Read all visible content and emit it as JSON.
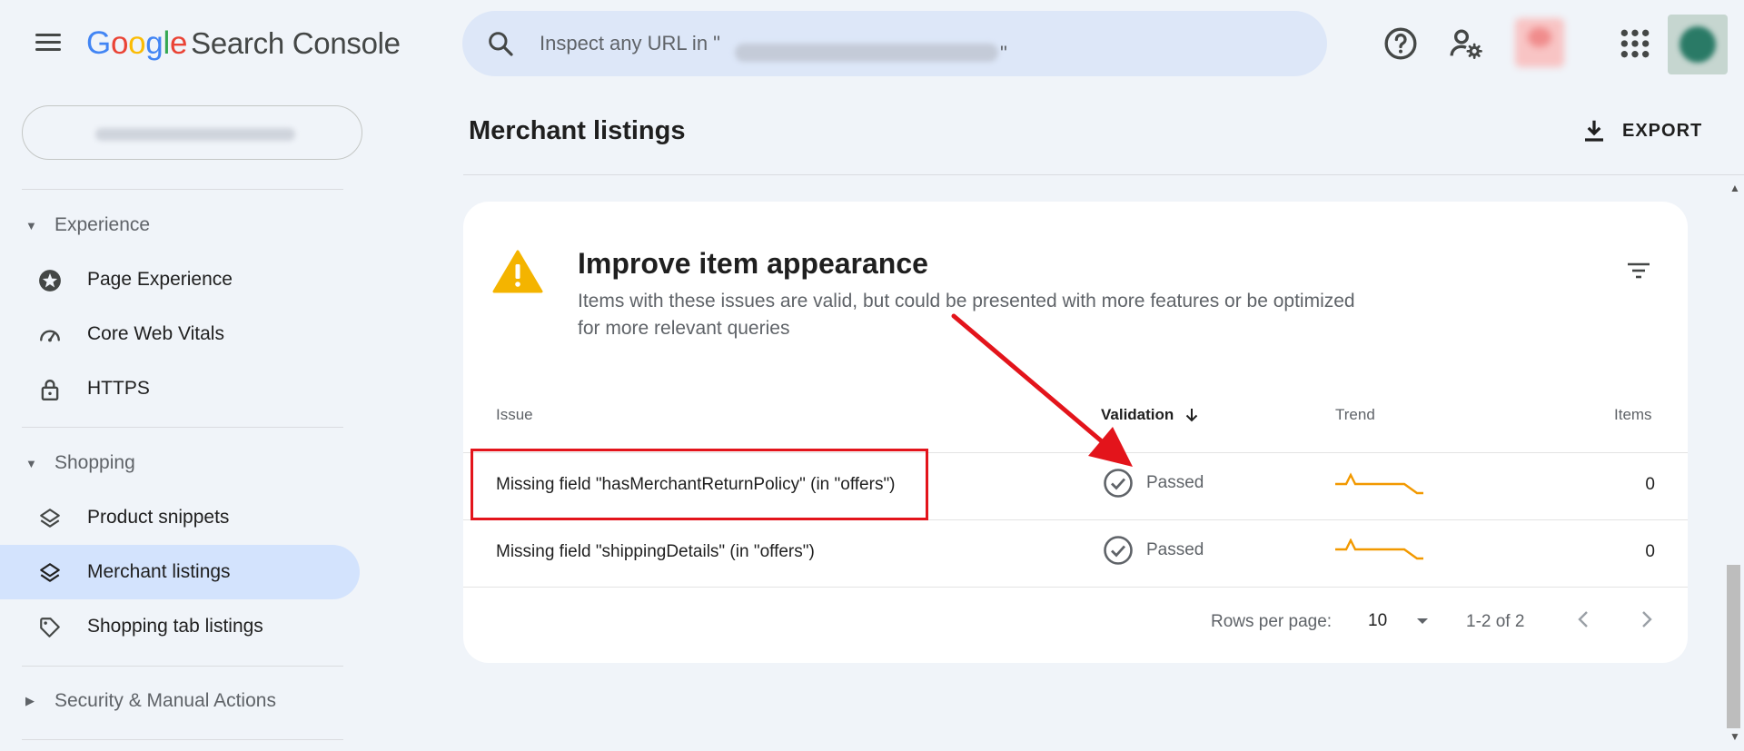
{
  "app": {
    "logo_google": [
      "G",
      "o",
      "o",
      "g",
      "l",
      "e"
    ],
    "product_name": "Search Console"
  },
  "search": {
    "placeholder": "Inspect any URL in \"",
    "quote_end": "\""
  },
  "sidebar": {
    "sections": [
      {
        "label": "Experience",
        "items": [
          {
            "label": "Page Experience",
            "icon": "page-experience-icon"
          },
          {
            "label": "Core Web Vitals",
            "icon": "gauge-icon"
          },
          {
            "label": "HTTPS",
            "icon": "lock-icon"
          }
        ]
      },
      {
        "label": "Shopping",
        "items": [
          {
            "label": "Product snippets",
            "icon": "layers-icon"
          },
          {
            "label": "Merchant listings",
            "icon": "layers-icon",
            "active": true
          },
          {
            "label": "Shopping tab listings",
            "icon": "tag-icon"
          }
        ]
      },
      {
        "label": "Security & Manual Actions",
        "items": []
      }
    ]
  },
  "main": {
    "title": "Merchant listings",
    "export_label": "EXPORT"
  },
  "card": {
    "title": "Improve item appearance",
    "description": "Items with these issues are valid, but could be presented with more features or be optimized for more relevant queries",
    "columns": {
      "issue": "Issue",
      "validation": "Validation",
      "trend": "Trend",
      "items": "Items"
    },
    "rows": [
      {
        "issue": "Missing field \"hasMerchantReturnPolicy\" (in \"offers\")",
        "validation": "Passed",
        "items": "0"
      },
      {
        "issue": "Missing field \"shippingDetails\" (in \"offers\")",
        "validation": "Passed",
        "items": "0"
      }
    ],
    "pagination": {
      "rows_per_page_label": "Rows per page:",
      "rows_per_page_value": "10",
      "range": "1-2 of 2"
    }
  },
  "colors": {
    "accent_active": "#d3e3fd",
    "warning": "#f4b400",
    "trend_line": "#f29900",
    "annotation": "#e3141b"
  }
}
